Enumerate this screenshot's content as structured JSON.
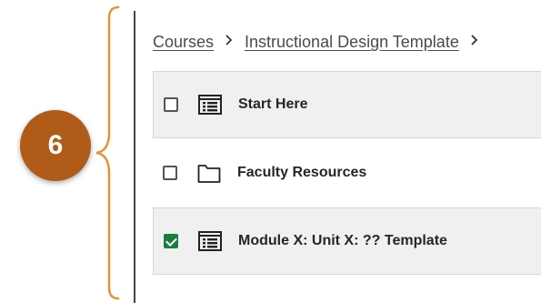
{
  "annotation": {
    "number": "6",
    "color": "#b15b19"
  },
  "breadcrumb": {
    "items": [
      {
        "label": "Courses"
      },
      {
        "label": "Instructional Design Template"
      }
    ],
    "separator": ">"
  },
  "content_items": [
    {
      "label": "Start Here",
      "icon": "document-icon",
      "checked": false,
      "shaded": true
    },
    {
      "label": "Faculty Resources",
      "icon": "folder-icon",
      "checked": false,
      "shaded": false
    },
    {
      "label": "Module X: Unit X: ?? Template",
      "icon": "document-icon",
      "checked": true,
      "shaded": true
    }
  ],
  "colors": {
    "check_green": "#1b7e3c",
    "row_shade": "#f0f0f0"
  }
}
